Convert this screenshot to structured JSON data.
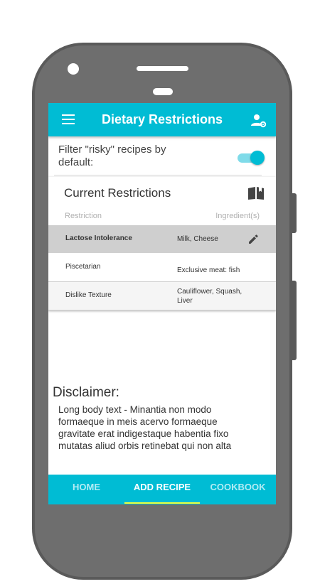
{
  "appbar": {
    "title": "Dietary Restrictions",
    "menu_icon": "menu-icon",
    "profile_icon": "user-settings-icon"
  },
  "filter": {
    "label": "Filter \"risky\" recipes by default:",
    "enabled": true
  },
  "restrictions": {
    "title": "Current Restrictions",
    "book_icon": "book-icon",
    "columns": {
      "restriction": "Restriction",
      "ingredients": "Ingredient(s)"
    },
    "rows": [
      {
        "restriction": "Lactose Intolerance",
        "ingredients": "Milk, Cheese",
        "selected": true
      },
      {
        "restriction": "Piscetarian",
        "ingredients": "Exclusive meat: fish"
      },
      {
        "restriction": "Dislike Texture",
        "ingredients": "Cauliflower, Squash, Liver"
      }
    ]
  },
  "disclaimer": {
    "title": "Disclaimer:",
    "body": "Long body text - Minantia non modo formaeque in meis acervo formaeque gravitate erat indigestaque habentia fixo mutatas aliud orbis retinebat qui non alta"
  },
  "nav": {
    "tabs": [
      {
        "label": "HOME",
        "active": false
      },
      {
        "label": "ADD RECIPE",
        "active": true
      },
      {
        "label": "COOKBOOK",
        "active": false
      }
    ]
  },
  "colors": {
    "accent": "#00bcd4",
    "tab_indicator": "#f0ff3c"
  }
}
